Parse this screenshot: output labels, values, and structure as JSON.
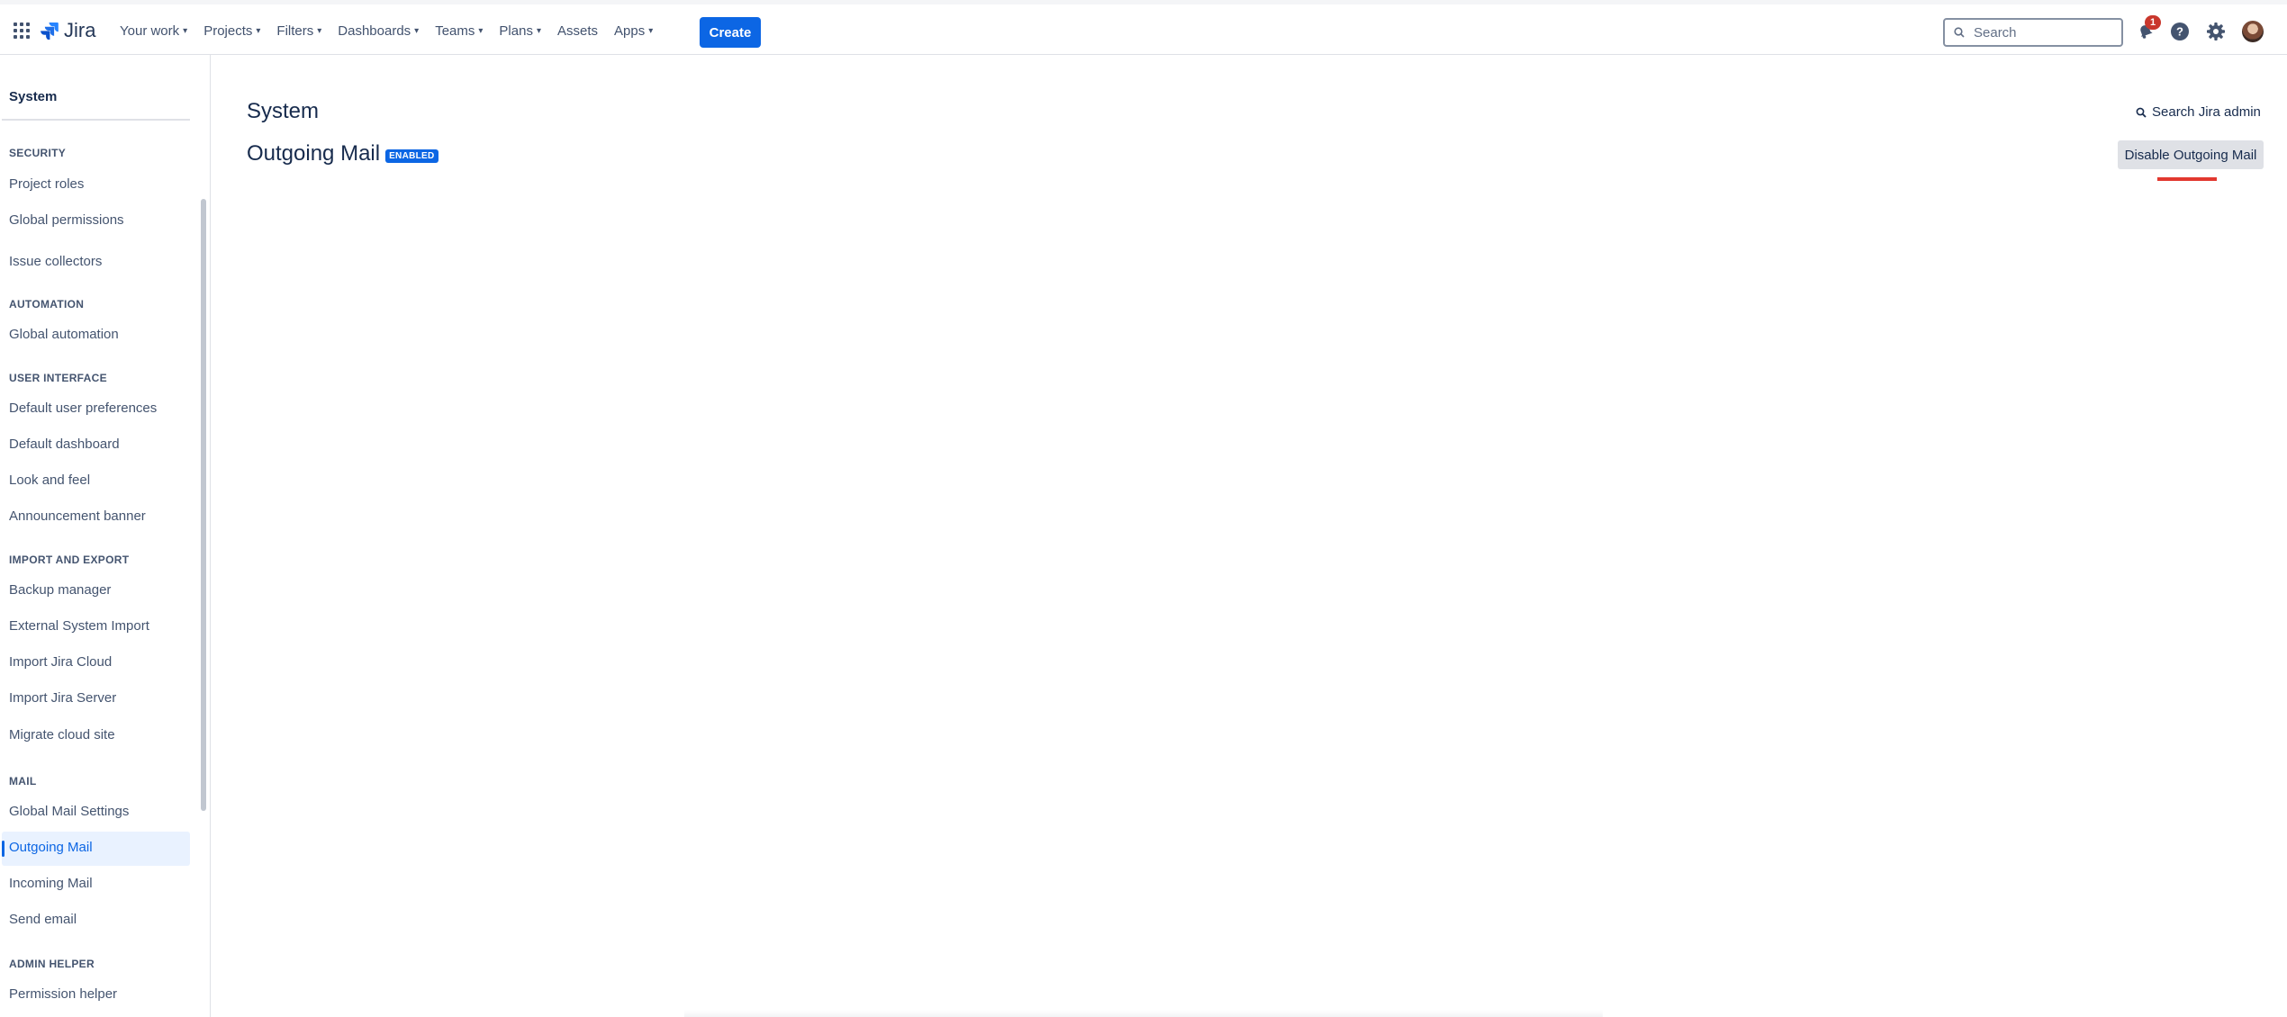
{
  "nav": {
    "logo_text": "Jira",
    "items": [
      {
        "label": "Your work"
      },
      {
        "label": "Projects"
      },
      {
        "label": "Filters"
      },
      {
        "label": "Dashboards"
      },
      {
        "label": "Teams"
      },
      {
        "label": "Plans"
      },
      {
        "label": "Assets"
      },
      {
        "label": "Apps"
      }
    ],
    "create_label": "Create",
    "search_placeholder": "Search",
    "notification_count": "1"
  },
  "sidebar": {
    "title": "System",
    "sections": [
      {
        "heading": "SECURITY",
        "items": [
          "Project roles",
          "Global permissions",
          "Issue collectors"
        ]
      },
      {
        "heading": "AUTOMATION",
        "items": [
          "Global automation"
        ]
      },
      {
        "heading": "USER INTERFACE",
        "items": [
          "Default user preferences",
          "Default dashboard",
          "Look and feel",
          "Announcement banner"
        ]
      },
      {
        "heading": "IMPORT AND EXPORT",
        "items": [
          "Backup manager",
          "External System Import",
          "Import Jira Cloud",
          "Import Jira Server",
          "Migrate cloud site"
        ]
      },
      {
        "heading": "MAIL",
        "items": [
          "Global Mail Settings",
          "Outgoing Mail",
          "Incoming Mail",
          "Send email"
        ]
      },
      {
        "heading": "ADMIN HELPER",
        "items": [
          "Permission helper"
        ]
      }
    ],
    "active_item": "Outgoing Mail"
  },
  "main": {
    "page_title": "System",
    "heading": "Outgoing Mail",
    "status_lozenge": "ENABLED",
    "admin_search_label": "Search Jira admin",
    "disable_button_label": "Disable Outgoing Mail"
  },
  "colors": {
    "accent": "#0c66e4",
    "active_bg": "#e9f2ff",
    "highlight_underline": "#e2382f"
  }
}
